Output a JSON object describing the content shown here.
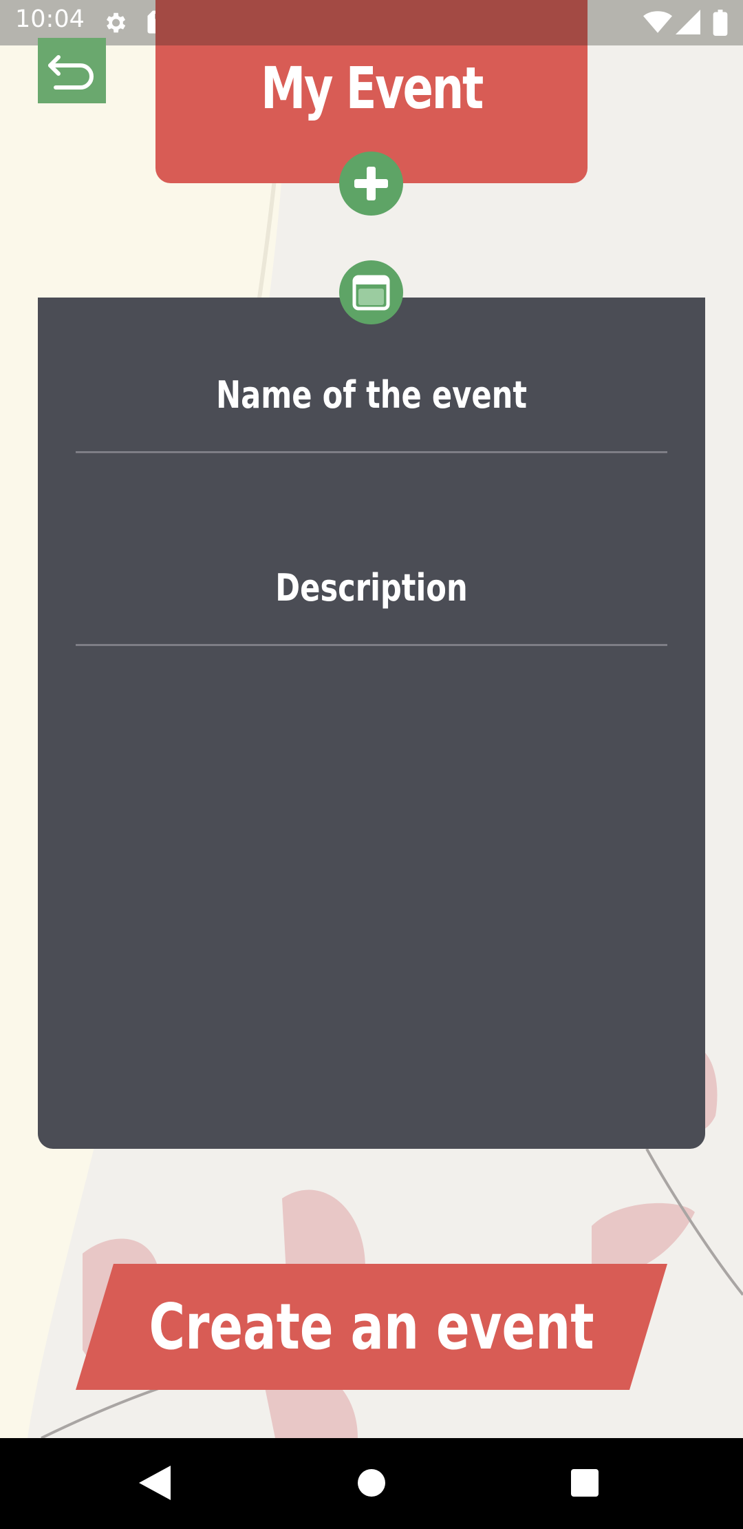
{
  "status_bar": {
    "time": "10:04",
    "icons": [
      "gear-icon",
      "sd-card-icon",
      "wifi-icon",
      "signal-icon",
      "battery-icon"
    ]
  },
  "header": {
    "title": "My Event"
  },
  "toolbar": {
    "back_icon": "back-arrow-icon",
    "add_icon": "plus-icon",
    "calendar_icon": "calendar-icon"
  },
  "form": {
    "name_placeholder": "Name of the event",
    "description_placeholder": "Description"
  },
  "actions": {
    "create_label": "Create an event"
  },
  "nav_bar": {
    "icons": [
      "back-triangle-icon",
      "home-circle-icon",
      "recents-square-icon"
    ]
  },
  "colors": {
    "header_red": "#d85c55",
    "green": "#5ea466",
    "card_dark": "#4b4d55",
    "background": "#f2f0ec"
  }
}
